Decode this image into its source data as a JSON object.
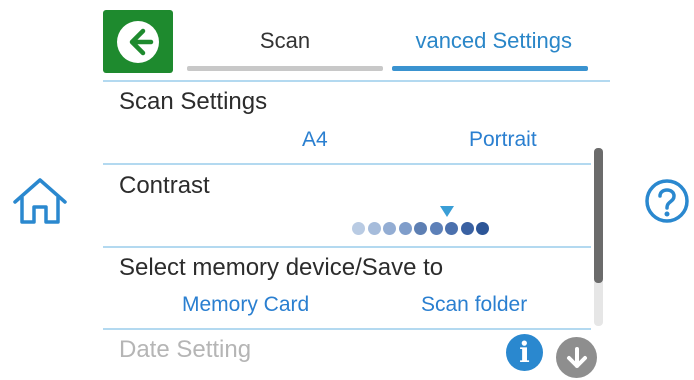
{
  "header": {
    "tabs": [
      {
        "label": "Scan",
        "active": false
      },
      {
        "label": "vanced Settings",
        "active": true
      }
    ]
  },
  "sections": {
    "scan_settings": {
      "title": "Scan Settings",
      "size": "A4",
      "orientation": "Portrait"
    },
    "contrast": {
      "title": "Contrast",
      "level": 5,
      "steps": 9
    },
    "memory": {
      "title": "Select memory device/Save to",
      "device": "Memory Card",
      "folder": "Scan folder"
    },
    "date": {
      "title": "Date Setting"
    }
  },
  "colors": {
    "back_button": "#1e8a2e",
    "accent": "#2a86c8",
    "separator": "#b3d9f0",
    "value_text": "#2a7fd0"
  },
  "icons": {
    "back": "arrow-left-icon",
    "home": "home-icon",
    "help": "help-icon",
    "info": "info-icon",
    "down": "arrow-down-icon"
  }
}
